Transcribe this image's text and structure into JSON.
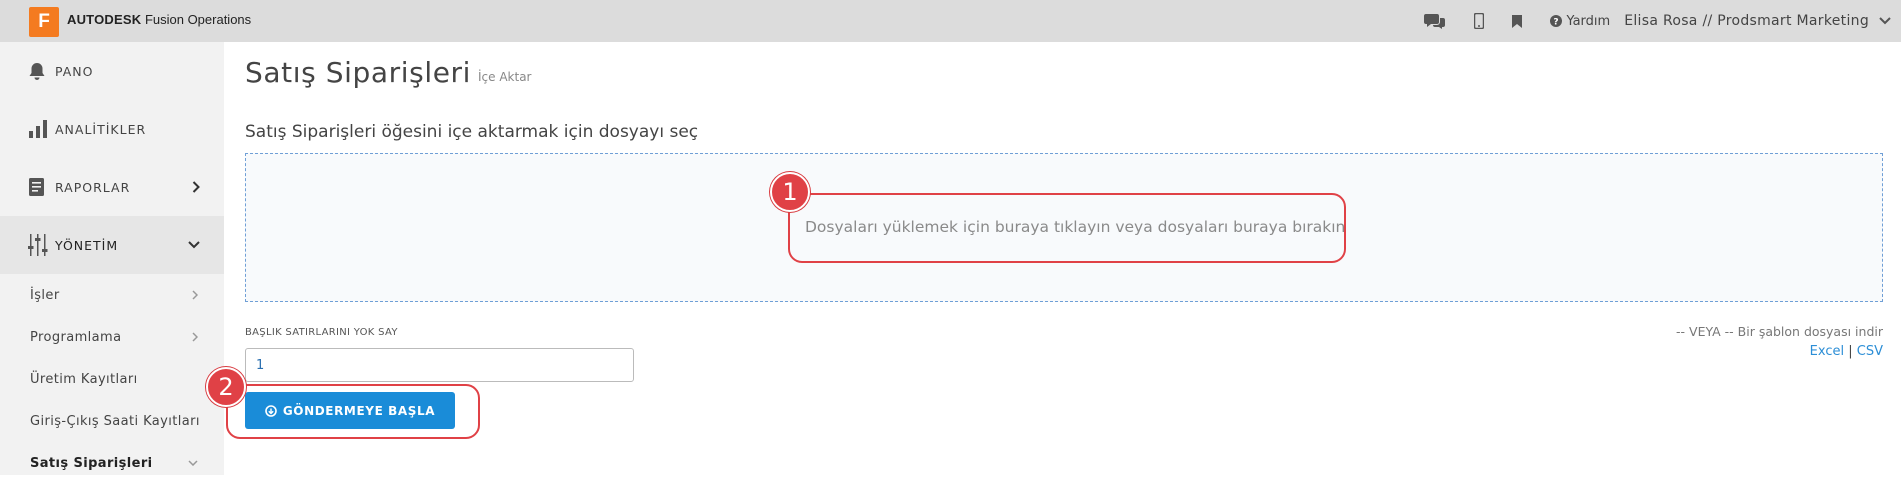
{
  "header": {
    "logo_letter": "F",
    "brand_bold": "AUTODESK",
    "brand_product": "Fusion Operations",
    "icons": [
      "chat-icon",
      "mobile-icon",
      "bookmark-icon"
    ],
    "help_label": "Yardım",
    "user_label": "Elisa Rosa // Prodsmart Marketing"
  },
  "sidebar": {
    "main_items": [
      {
        "label": "PANO",
        "icon": "bell-icon"
      },
      {
        "label": "ANALİTİKLER",
        "icon": "bar-chart-icon"
      },
      {
        "label": "RAPORLAR",
        "icon": "report-icon"
      },
      {
        "label": "YÖNETİM",
        "icon": "sliders-icon"
      }
    ],
    "sub_items": [
      {
        "label": "İşler"
      },
      {
        "label": "Programlama"
      },
      {
        "label": "Üretim Kayıtları"
      },
      {
        "label": "Giriş-Çıkış Saati Kayıtları"
      },
      {
        "label": "Satış Siparişleri"
      }
    ]
  },
  "main": {
    "title": "Satış Siparişleri",
    "breadcrumb": "İçe Aktar",
    "section_title": "Satış Siparişleri öğesini içe aktarmak için dosyayı seç",
    "dropzone_message": "Dosyaları yüklemek için buraya tıklayın veya dosyaları buraya bırakın",
    "skip_rows_label": "BAŞLIK SATIRLARINI YOK SAY",
    "skip_rows_value": "1",
    "template_text": "-- VEYA -- Bir şablon dosyası indir",
    "template_excel": "Excel",
    "template_separator": "|",
    "template_csv": "CSV",
    "submit_label": "GÖNDERMEYE BAŞLA"
  },
  "annotations": [
    {
      "number": "1"
    },
    {
      "number": "2"
    }
  ],
  "colors": {
    "accent": "#1a8cd8",
    "logo": "#f47b20",
    "annotation": "#e04146"
  }
}
